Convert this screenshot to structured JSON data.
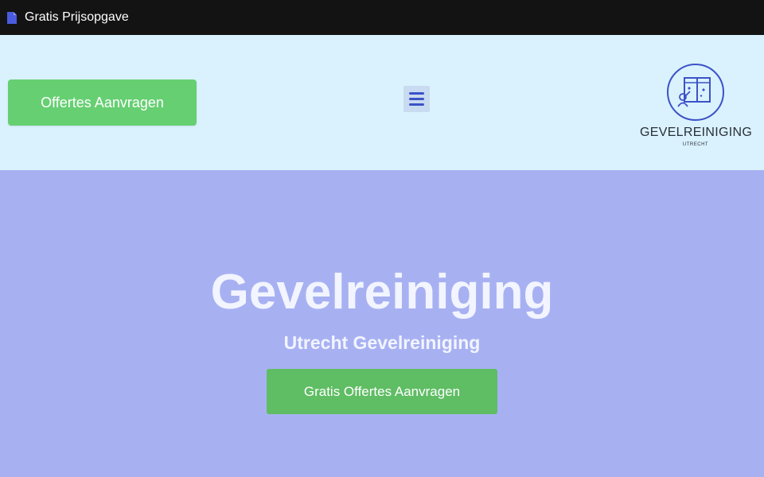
{
  "topbar": {
    "title": "Gratis Prijsopgave",
    "icon": "document-icon"
  },
  "header": {
    "cta_label": "Offertes Aanvragen",
    "menu_icon": "hamburger-menu-icon",
    "logo": {
      "name": "GEVELREINIGING",
      "sub": "UTRECHT"
    }
  },
  "hero": {
    "title": "Gevelreiniging",
    "subtitle": "Utrecht Gevelreiniging",
    "cta_label": "Gratis Offertes Aanvragen"
  },
  "colors": {
    "topbar_bg": "#131313",
    "header_bg": "#d9f2fd",
    "hero_bg": "#a7b1f2",
    "cta_green": "#66cf72",
    "accent_blue": "#3d52c8"
  }
}
